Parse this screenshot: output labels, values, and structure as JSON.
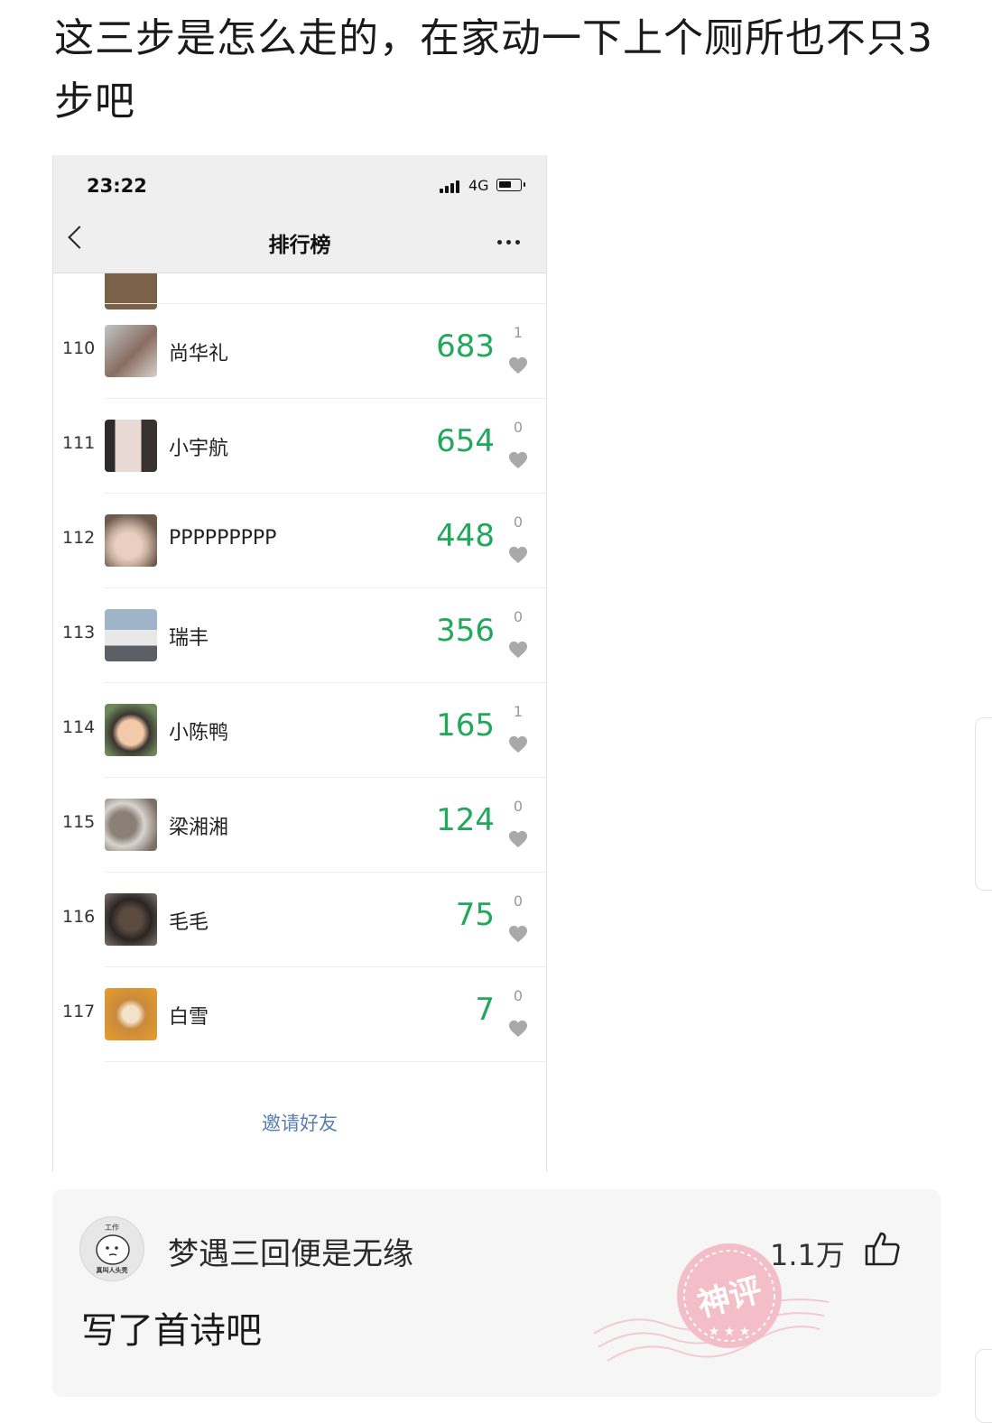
{
  "post": {
    "text": "这三步是怎么走的，在家动一下上个厕所也不只3步吧"
  },
  "phone": {
    "status": {
      "time": "23:22",
      "network": "4G"
    },
    "nav": {
      "title": "排行榜"
    },
    "accent_color": "#21a85a",
    "rows": [
      {
        "rank": "110",
        "name": "尚华礼",
        "steps": "683",
        "likes": "1"
      },
      {
        "rank": "111",
        "name": "小宇航",
        "steps": "654",
        "likes": "0"
      },
      {
        "rank": "112",
        "name": "PPPPPPPPP",
        "steps": "448",
        "likes": "0"
      },
      {
        "rank": "113",
        "name": "瑞丰",
        "steps": "356",
        "likes": "0"
      },
      {
        "rank": "114",
        "name": "小陈鸭",
        "steps": "165",
        "likes": "1"
      },
      {
        "rank": "115",
        "name": "梁湘湘",
        "steps": "124",
        "likes": "0"
      },
      {
        "rank": "116",
        "name": "毛毛",
        "steps": "75",
        "likes": "0"
      },
      {
        "rank": "117",
        "name": "白雪",
        "steps": "7",
        "likes": "0"
      }
    ],
    "invite_label": "邀请好友"
  },
  "comment": {
    "username": "梦遇三回便是无缘",
    "text": "写了首诗吧",
    "like_count": "1.1万",
    "badge": "神评",
    "avatar_caption_top": "工作",
    "avatar_caption_bottom": "真叫人头秃"
  }
}
